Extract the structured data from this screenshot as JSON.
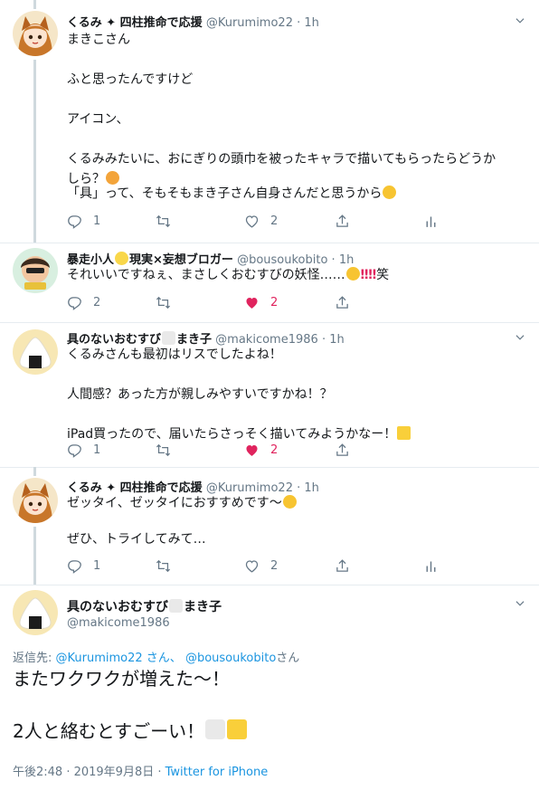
{
  "tweets": [
    {
      "name": "くるみ ✦ 四柱推命で応援",
      "handle": "@Kurumimo22",
      "time": "1h",
      "text": "まきこさん\n\nふと思ったんですけど\n\nアイコン、\n\nくるみみたいに、おにぎりの頭巾を被ったキャラで描いてもらったらどうか\nしら？",
      "text2": "「具」って、そもそもまき子さん自身さんだと思うから",
      "replies": "1",
      "retweets": "",
      "likes": "2"
    },
    {
      "name": "暴走小人",
      "name_suffix": "現実×妄想ブロガー",
      "handle": "@bousoukobito",
      "time": "1h",
      "text": "それいいですねぇ、まさしくおむすびの妖怪……",
      "text_tail": "笑",
      "replies": "2",
      "retweets": "",
      "likes": "2"
    },
    {
      "name": "具のないおむすび",
      "name_suffix": "まき子",
      "handle": "@makicome1986",
      "time": "1h",
      "text": "くるみさんも最初はリスでしたよね！\n\n人間感？あった方が親しみやすいですかね！？\n\niPad買ったので、届いたらさっそく描いてみようかなー！",
      "replies": "1",
      "retweets": "",
      "likes": "2"
    },
    {
      "name": "くるみ ✦ 四柱推命で応援",
      "handle": "@Kurumimo22",
      "time": "1h",
      "text": "ゼッタイ、ゼッタイにおすすめです〜",
      "text2": "ぜひ、トライしてみて…",
      "replies": "1",
      "retweets": "",
      "likes": "2"
    }
  ],
  "main": {
    "name": "具のないおむすび",
    "name_suffix": "まき子",
    "handle": "@makicome1986",
    "reply_prefix": "返信先:",
    "reply_user1": "@Kurumimo22 さん、",
    "reply_user2": "@bousoukobito",
    "reply_suffix": "さん",
    "line1": "またワクワクが増えた〜！",
    "line2": "2人と絡むとすごーい！",
    "time": "午後2:48 · 2019年9月8日 ·",
    "source": "Twitter for iPhone"
  },
  "colors": {
    "accent": "#1b95e0",
    "like": "#e0245e",
    "muted": "#657786",
    "thread_line": "#cfd9de"
  },
  "icons": [
    "reply-icon",
    "retweet-icon",
    "like-icon",
    "share-icon",
    "analytics-icon",
    "chevron-down-icon"
  ]
}
